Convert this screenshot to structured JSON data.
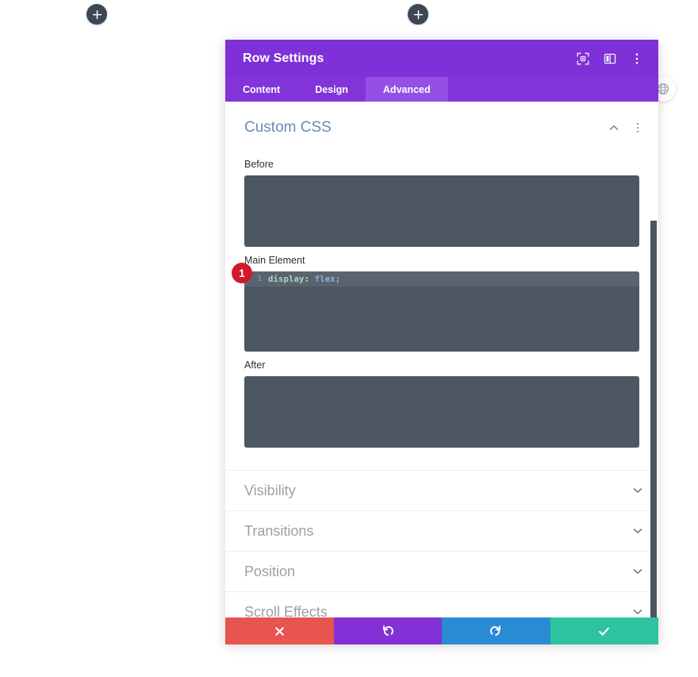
{
  "canvas": {
    "add_buttons": [
      {
        "name": "add-module-left",
        "label": "+"
      },
      {
        "name": "add-module-right",
        "label": "+"
      }
    ],
    "globe_handle": {
      "icon": "globe-icon"
    }
  },
  "panel": {
    "header": {
      "title": "Row Settings",
      "icons": [
        {
          "name": "fullscreen-icon",
          "label": ""
        },
        {
          "name": "layout-view-icon",
          "label": ""
        },
        {
          "name": "more-options-icon",
          "label": ""
        }
      ]
    },
    "tabs": [
      {
        "label": "Content",
        "active": false
      },
      {
        "label": "Design",
        "active": false
      },
      {
        "label": "Advanced",
        "active": true
      }
    ],
    "custom_css": {
      "title": "Custom CSS",
      "collapse_icon": "chevron-up-icon",
      "more_icon": "more-options-icon",
      "fields": [
        {
          "label": "Before",
          "value": ""
        },
        {
          "label": "Main Element",
          "value": "display: flex;"
        },
        {
          "label": "After",
          "value": ""
        }
      ],
      "main_element": {
        "label": "Main Element",
        "line_number": "1",
        "tokens": {
          "property": "display",
          "colon": ":",
          "value": " flex",
          "semicolon": ";"
        },
        "step_badge": "1"
      }
    },
    "collapsed_sections": [
      {
        "label": "Visibility",
        "chevron": "chevron-down-icon"
      },
      {
        "label": "Transitions",
        "chevron": "chevron-down-icon"
      },
      {
        "label": "Position",
        "chevron": "chevron-down-icon"
      },
      {
        "label": "Scroll Effects",
        "chevron": "chevron-down-icon"
      }
    ],
    "footer": [
      {
        "name": "cancel-button",
        "icon": "close-icon",
        "color": "#e8544f"
      },
      {
        "name": "undo-button",
        "icon": "undo-icon",
        "color": "#8331d6"
      },
      {
        "name": "redo-button",
        "icon": "redo-icon",
        "color": "#2a8bd5"
      },
      {
        "name": "save-button",
        "icon": "checkmark-icon",
        "color": "#2ec3a0"
      }
    ]
  },
  "colors": {
    "header_purple": "#7f30d6",
    "tabs_purple": "#8234d8",
    "tab_active_purple": "#9450e4",
    "code_bg": "#4d5763",
    "badge_red": "#d1192b",
    "section_title_blue": "#6b8bb5"
  }
}
